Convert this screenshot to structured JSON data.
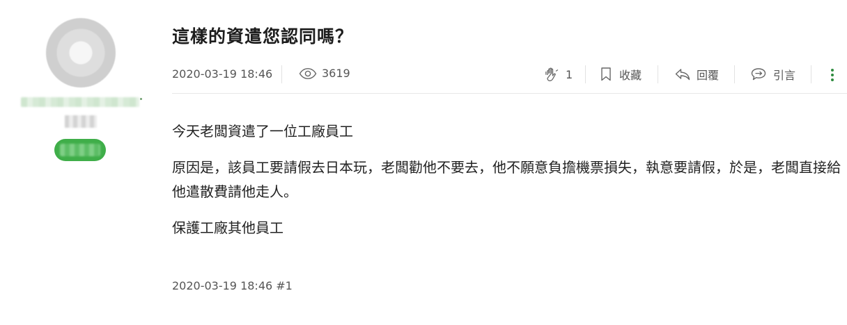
{
  "post": {
    "title": "這樣的資遣您認同嗎？",
    "date": "2020-03-19 18:46",
    "views": "3619",
    "actions": {
      "like_count": "1",
      "favorite_label": "收藏",
      "reply_label": "回覆",
      "quote_label": "引言"
    },
    "paragraphs": [
      "今天老闆資遣了一位工廠員工",
      "原因是，該員工要請假去日本玩，老闆勸他不要去，他不願意負擔機票損失，執意要請假，於是，老闆直接給他遣散費請他走人。",
      "保護工廠其他員工"
    ],
    "footer": "2020-03-19 18:46 #1"
  },
  "colors": {
    "accent_green": "#3fae49",
    "more_dots": "#2e8b3e",
    "meta_text": "#555555"
  },
  "icons": {
    "views": "eye-icon",
    "like": "hand-clap-icon",
    "favorite": "bookmark-icon",
    "reply": "reply-arrow-icon",
    "quote": "speech-bubble-icon",
    "more": "vertical-dots-icon"
  }
}
